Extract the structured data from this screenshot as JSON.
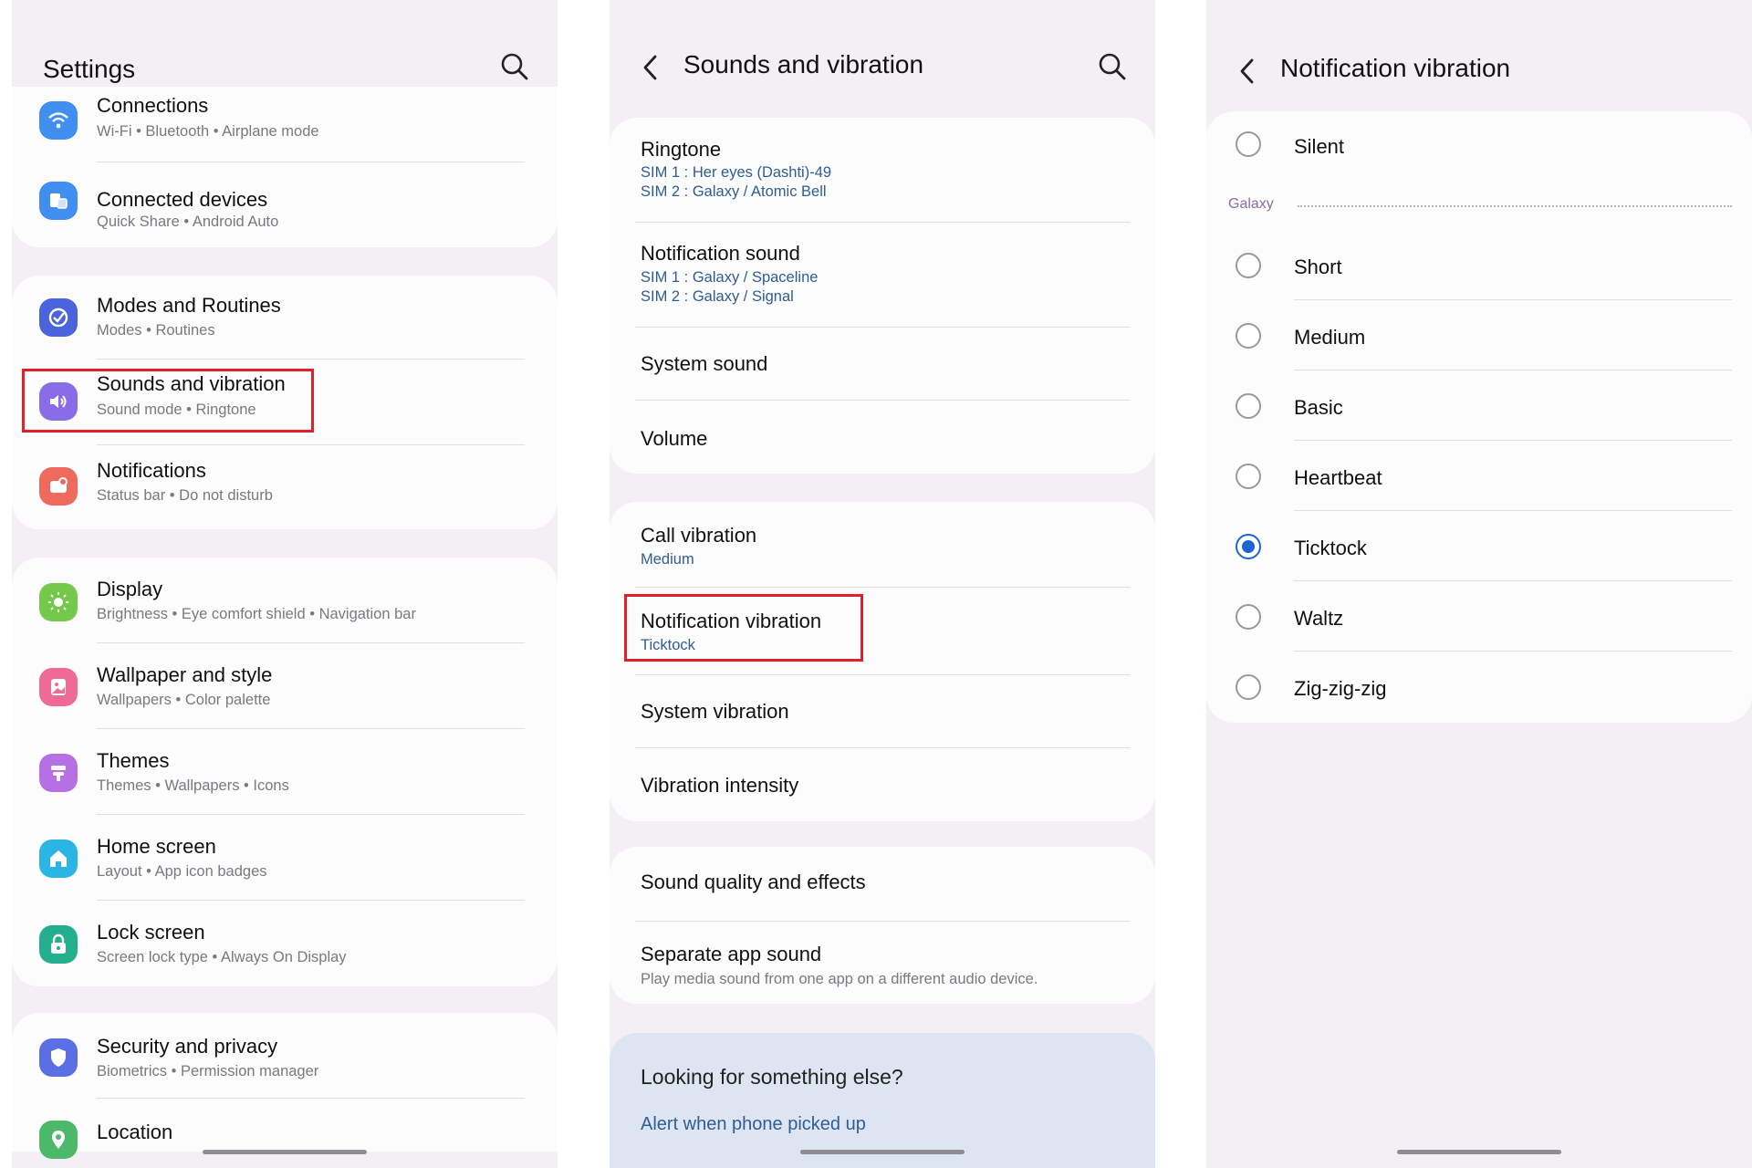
{
  "settings": {
    "title": "Settings",
    "items": [
      {
        "label": "Connections",
        "sub": "Wi-Fi  •  Bluetooth  •  Airplane mode",
        "icon": "wifi-icon",
        "color": "#3f8ef0"
      },
      {
        "label": "Connected devices",
        "sub": "Quick Share  •  Android Auto",
        "icon": "connected-devices-icon",
        "color": "#3f8ef0"
      },
      {
        "label": "Modes and Routines",
        "sub": "Modes  •  Routines",
        "icon": "modes-routines-icon",
        "color": "#4b63dc"
      },
      {
        "label": "Sounds and vibration",
        "sub": "Sound mode  •  Ringtone",
        "icon": "speaker-icon",
        "color": "#8a6ce9"
      },
      {
        "label": "Notifications",
        "sub": "Status bar  •  Do not disturb",
        "icon": "notification-icon",
        "color": "#f0695d"
      },
      {
        "label": "Display",
        "sub": "Brightness  •  Eye comfort shield  •  Navigation bar",
        "icon": "sun-icon",
        "color": "#74c84a"
      },
      {
        "label": "Wallpaper and style",
        "sub": "Wallpapers  •  Color palette",
        "icon": "wallpaper-icon",
        "color": "#ee6b93"
      },
      {
        "label": "Themes",
        "sub": "Themes  •  Wallpapers  •  Icons",
        "icon": "themes-icon",
        "color": "#b76fe4"
      },
      {
        "label": "Home screen",
        "sub": "Layout  •  App icon badges",
        "icon": "home-icon",
        "color": "#2ab5e4"
      },
      {
        "label": "Lock screen",
        "sub": "Screen lock type  •  Always On Display",
        "icon": "lock-icon",
        "color": "#23ae8e"
      },
      {
        "label": "Security and privacy",
        "sub": "Biometrics  •  Permission manager",
        "icon": "shield-icon",
        "color": "#5a6fe4"
      },
      {
        "label": "Location",
        "sub": "",
        "icon": "location-icon",
        "color": "#4cb96a"
      }
    ]
  },
  "sounds": {
    "title": "Sounds and vibration",
    "ringtone": {
      "label": "Ringtone",
      "sub1": "SIM 1 : Her eyes (Dashti)-49",
      "sub2": "SIM 2 : Galaxy / Atomic Bell"
    },
    "notification_sound": {
      "label": "Notification sound",
      "sub1": "SIM 1 : Galaxy / Spaceline",
      "sub2": "SIM 2 : Galaxy / Signal"
    },
    "system_sound": "System sound",
    "volume": "Volume",
    "call_vibration": {
      "label": "Call vibration",
      "sub": "Medium"
    },
    "notification_vibration": {
      "label": "Notification vibration",
      "sub": "Ticktock"
    },
    "system_vibration": "System vibration",
    "vibration_intensity": "Vibration intensity",
    "sound_quality": "Sound quality and effects",
    "separate_app_sound": {
      "label": "Separate app sound",
      "sub": "Play media sound from one app on a different audio device."
    },
    "looking": {
      "title": "Looking for something else?",
      "link": "Alert when phone picked up"
    }
  },
  "vibration": {
    "title": "Notification vibration",
    "silent": "Silent",
    "section": "Galaxy",
    "options": [
      "Short",
      "Medium",
      "Basic",
      "Heartbeat",
      "Ticktock",
      "Waltz",
      "Zig-zig-zig"
    ],
    "selected": "Ticktock"
  },
  "colors": {
    "accent": "#1b66d1",
    "highlight": "#e0202a",
    "link": "#2e5d93"
  }
}
